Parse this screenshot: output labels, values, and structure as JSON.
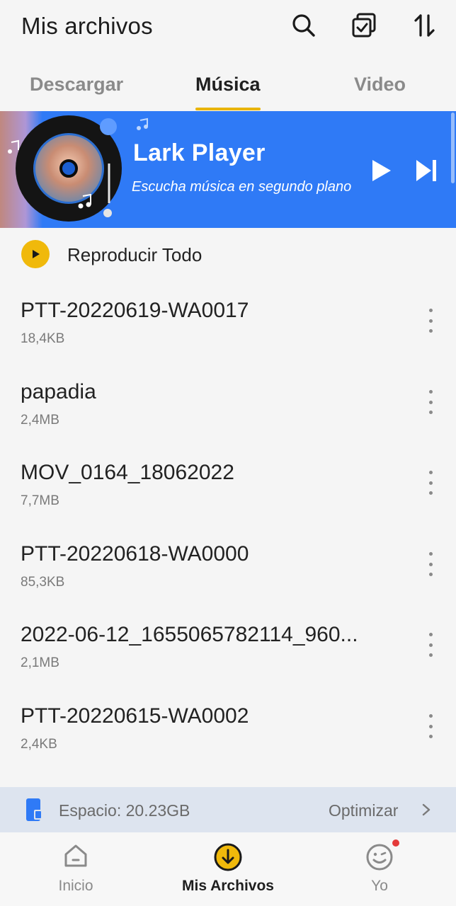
{
  "header": {
    "title": "Mis archivos",
    "icons": [
      "search-icon",
      "select-all-icon",
      "sort-icon"
    ]
  },
  "tabs": [
    {
      "label": "Descargar",
      "active": false
    },
    {
      "label": "Música",
      "active": true
    },
    {
      "label": "Video",
      "active": false
    }
  ],
  "banner": {
    "app_name": "Lark Player",
    "subtitle": "Escucha música en segundo plano",
    "bg_color": "#2f7af6"
  },
  "play_all": {
    "label": "Reproducir Todo",
    "accent": "#f0b90b"
  },
  "files": [
    {
      "name": "PTT-20220619-WA0017",
      "size": "18,4KB"
    },
    {
      "name": "papadia",
      "size": "2,4MB"
    },
    {
      "name": "MOV_0164_18062022",
      "size": "7,7MB"
    },
    {
      "name": "PTT-20220618-WA0000",
      "size": "85,3KB"
    },
    {
      "name": "2022-06-12_1655065782114_960...",
      "size": "2,1MB"
    },
    {
      "name": "PTT-20220615-WA0002",
      "size": "2,4KB"
    }
  ],
  "storage": {
    "space_label": "Espacio: 20.23GB",
    "optimize_label": "Optimizar"
  },
  "bottom_nav": [
    {
      "label": "Inicio",
      "icon": "home-icon",
      "active": false
    },
    {
      "label": "Mis Archivos",
      "icon": "download-circle-icon",
      "active": true
    },
    {
      "label": "Yo",
      "icon": "smile-face-icon",
      "active": false
    }
  ]
}
